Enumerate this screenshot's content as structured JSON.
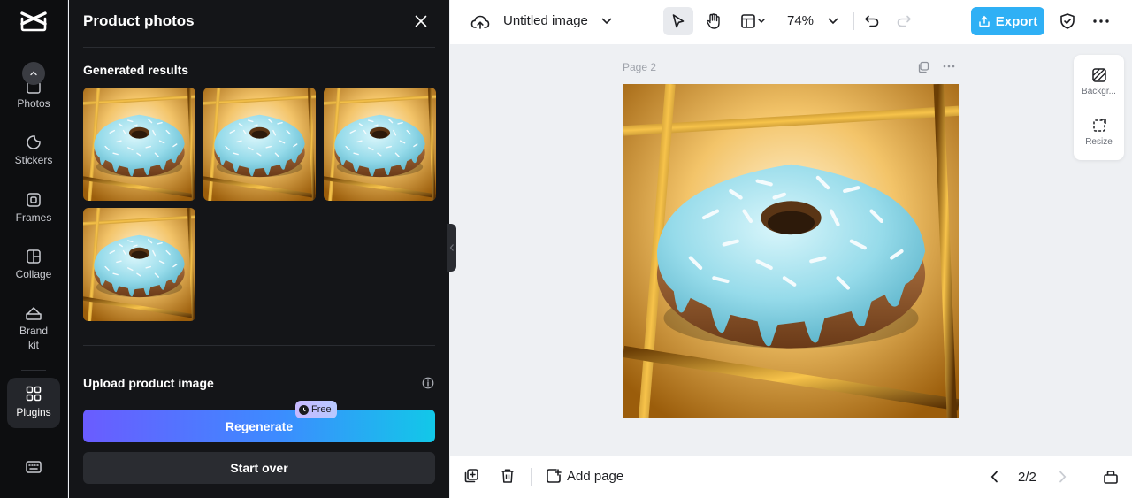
{
  "rail": {
    "items": [
      {
        "label": "Photos"
      },
      {
        "label": "Stickers"
      },
      {
        "label": "Frames"
      },
      {
        "label": "Collage"
      },
      {
        "label": "Brand kit"
      },
      {
        "label": "Plugins"
      }
    ],
    "active": "Plugins"
  },
  "panel": {
    "title": "Product photos",
    "generated_title": "Generated results",
    "upload_title": "Upload product image",
    "regenerate_label": "Regenerate",
    "free_badge": "Free",
    "start_over_label": "Start over"
  },
  "topbar": {
    "doc_title": "Untitled image",
    "zoom": "74%",
    "export_label": "Export"
  },
  "canvas": {
    "page_label": "Page 2"
  },
  "side_tools": {
    "background_label": "Backgr...",
    "resize_label": "Resize"
  },
  "bottombar": {
    "add_page_label": "Add page",
    "page_count": "2/2"
  },
  "colors": {
    "accent": "#2fb0f5",
    "panel_bg": "#141518",
    "rail_bg": "#0d0e10",
    "gradient_start": "#6a5cff",
    "gradient_end": "#12c8e8"
  }
}
